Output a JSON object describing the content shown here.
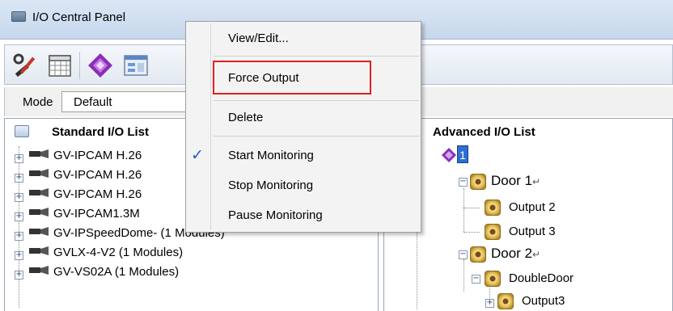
{
  "window": {
    "title": "I/O Central Panel"
  },
  "toolbar": {
    "buttons": [
      "tools-icon",
      "calendar-icon",
      "gem-icon",
      "panel-icon"
    ]
  },
  "mode": {
    "label": "Mode",
    "value": "Default"
  },
  "standard": {
    "title": "Standard I/O List",
    "items": [
      "GV-IPCAM H.26",
      "GV-IPCAM H.26",
      "GV-IPCAM H.26",
      "GV-IPCAM1.3M",
      "GV-IPSpeedDome- (1 Modules)",
      "GVLX-4-V2 (1 Modules)",
      "GV-VS02A (1 Modules)"
    ]
  },
  "advanced": {
    "title": "Advanced I/O List",
    "root_label": "1",
    "nodes": {
      "door1": "Door 1",
      "output2": "Output 2",
      "output3": "Output 3",
      "door2": "Door 2",
      "doubledoor": "DoubleDoor",
      "output3b": "Output3"
    },
    "paragraph_mark": "↵"
  },
  "context_menu": {
    "items": {
      "view_edit": "View/Edit...",
      "force_output": "Force Output",
      "delete": "Delete",
      "start_monitoring": "Start Monitoring",
      "stop_monitoring": "Stop Monitoring",
      "pause_monitoring": "Pause Monitoring"
    },
    "checked_item": "Start Monitoring",
    "check_glyph": "✓",
    "highlight_color": "#e02020"
  }
}
